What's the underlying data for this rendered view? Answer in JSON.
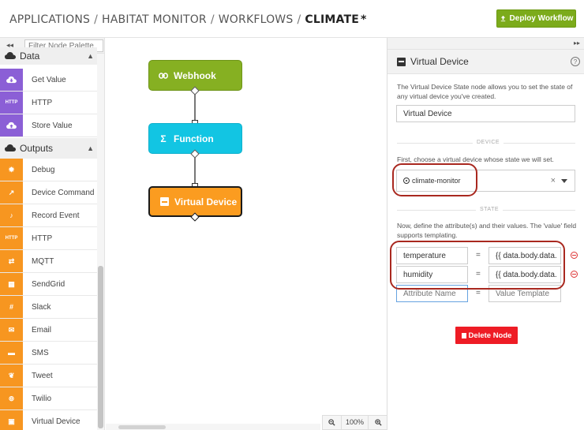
{
  "header": {
    "breadcrumb": [
      "APPLICATIONS",
      "HABITAT MONITOR",
      "WORKFLOWS"
    ],
    "current": "CLIMATE",
    "modified_marker": "*",
    "separator": "/",
    "deploy_label": "Deploy Workflow",
    "deploy_color": "#7cab1b"
  },
  "palette": {
    "collapse_icon": "double-chevron-left-icon",
    "filter_placeholder": "Filter Node Palette",
    "data_category": "Data",
    "data_items": [
      {
        "label": "Get Value",
        "icon": "cloud-download-icon"
      },
      {
        "label": "HTTP",
        "icon": "http-icon",
        "tile_text": "HTTP"
      },
      {
        "label": "Store Value",
        "icon": "cloud-upload-icon"
      }
    ],
    "outputs_category": "Outputs",
    "output_items": [
      {
        "label": "Debug",
        "icon": "bug-icon"
      },
      {
        "label": "Device Command",
        "icon": "arrow-up-right-icon"
      },
      {
        "label": "Record Event",
        "icon": "bell-icon"
      },
      {
        "label": "HTTP",
        "icon": "http-icon",
        "tile_text": "HTTP"
      },
      {
        "label": "MQTT",
        "icon": "exchange-icon"
      },
      {
        "label": "SendGrid",
        "icon": "sendgrid-icon"
      },
      {
        "label": "Slack",
        "icon": "slack-icon"
      },
      {
        "label": "Email",
        "icon": "envelope-icon"
      },
      {
        "label": "SMS",
        "icon": "chat-bubble-icon"
      },
      {
        "label": "Tweet",
        "icon": "twitter-bird-icon"
      },
      {
        "label": "Twilio",
        "icon": "twilio-icon"
      },
      {
        "label": "Virtual Device",
        "icon": "virtual-device-icon"
      }
    ],
    "colors": {
      "data": "#8b5fd6",
      "outputs": "#f79620"
    }
  },
  "canvas": {
    "nodes": [
      {
        "label": "Webhook",
        "icon": "link-icon",
        "color": "#86b022"
      },
      {
        "label": "Function",
        "icon": "sigma-icon",
        "color": "#12c5e3"
      },
      {
        "label": "Virtual Device",
        "icon": "virtual-device-icon",
        "color": "#fb9c20"
      }
    ],
    "zoom_out_icon": "zoom-out-icon",
    "zoom_level": "100%",
    "zoom_in_icon": "zoom-in-icon"
  },
  "panel": {
    "collapse_icon": "double-chevron-right-icon",
    "title": "Virtual Device",
    "help_icon": "question-circle-icon",
    "help_text": "?",
    "description": "The Virtual Device State node allows you to set the state of any virtual device you've created.",
    "node_name_value": "Virtual Device",
    "device_section": "DEVICE",
    "device_instruction": "First, choose a virtual device whose state we will set.",
    "selected_device": "climate-monitor",
    "clear_symbol": "×",
    "state_section": "STATE",
    "state_instruction": "Now, define the attribute(s) and their values. The 'value' field supports templating.",
    "equals": "=",
    "attributes": [
      {
        "name": "temperature",
        "value": "{{ data.body.data."
      },
      {
        "name": "humidity",
        "value": "{{ data.body.data."
      }
    ],
    "new_attribute_placeholder": "Attribute Name",
    "new_value_placeholder": "Value Template",
    "delete_label": "Delete Node",
    "delete_color": "#ee1c25"
  }
}
